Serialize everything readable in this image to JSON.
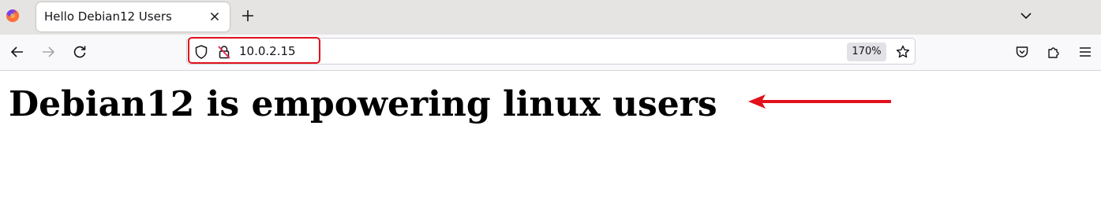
{
  "browser": {
    "tab": {
      "title": "Hello Debian12 Users"
    },
    "address_bar": {
      "url": "10.0.2.15"
    },
    "zoom_level": "170%"
  },
  "page": {
    "heading": "Debian12 is empowering linux users"
  },
  "icons": [
    "firefox-logo-icon",
    "close-icon",
    "plus-icon",
    "chevron-down-icon",
    "back-arrow-icon",
    "forward-arrow-icon",
    "reload-icon",
    "shield-icon",
    "insecure-lock-icon",
    "star-icon",
    "pocket-icon",
    "extensions-icon",
    "hamburger-menu-icon",
    "red-arrow-icon"
  ],
  "colors": {
    "annotation_red": "#e2111b",
    "tab_strip_bg": "#e6e4e2",
    "navbar_bg": "#f9f9fb"
  }
}
